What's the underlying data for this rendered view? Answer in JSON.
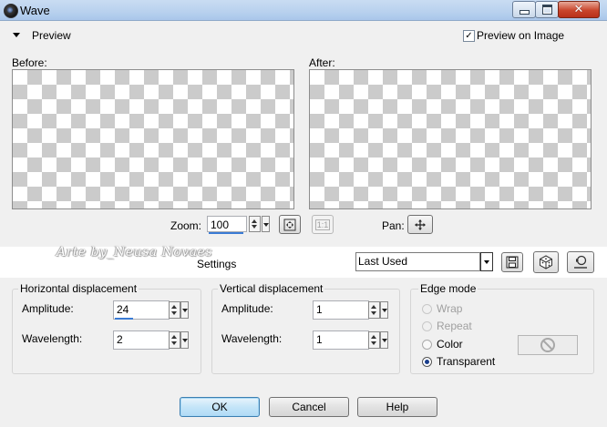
{
  "window": {
    "title": "Wave"
  },
  "preview": {
    "section_label": "Preview",
    "preview_on_image_label": "Preview on Image",
    "preview_on_image_checked": true,
    "before_label": "Before:",
    "after_label": "After:"
  },
  "zoom": {
    "label": "Zoom:",
    "value": "100",
    "fit_label": "1:1"
  },
  "pan": {
    "label": "Pan:"
  },
  "watermark": {
    "text": "Arte by_Neusa Novaes"
  },
  "settings": {
    "label": "Settings",
    "selected": "Last Used"
  },
  "horizontal": {
    "title": "Horizontal displacement",
    "amplitude_label": "Amplitude:",
    "amplitude_value": "24",
    "wavelength_label": "Wavelength:",
    "wavelength_value": "2"
  },
  "vertical": {
    "title": "Vertical displacement",
    "amplitude_label": "Amplitude:",
    "amplitude_value": "1",
    "wavelength_label": "Wavelength:",
    "wavelength_value": "1"
  },
  "edge_mode": {
    "title": "Edge mode",
    "options": [
      {
        "label": "Wrap",
        "enabled": false,
        "selected": false
      },
      {
        "label": "Repeat",
        "enabled": false,
        "selected": false
      },
      {
        "label": "Color",
        "enabled": true,
        "selected": false
      },
      {
        "label": "Transparent",
        "enabled": true,
        "selected": true
      }
    ]
  },
  "buttons": {
    "ok": "OK",
    "cancel": "Cancel",
    "help": "Help"
  },
  "colors": {
    "accent": "#3a7bd5",
    "checker_dark": "#cbcbcb",
    "checker_light": "#ffffff"
  }
}
